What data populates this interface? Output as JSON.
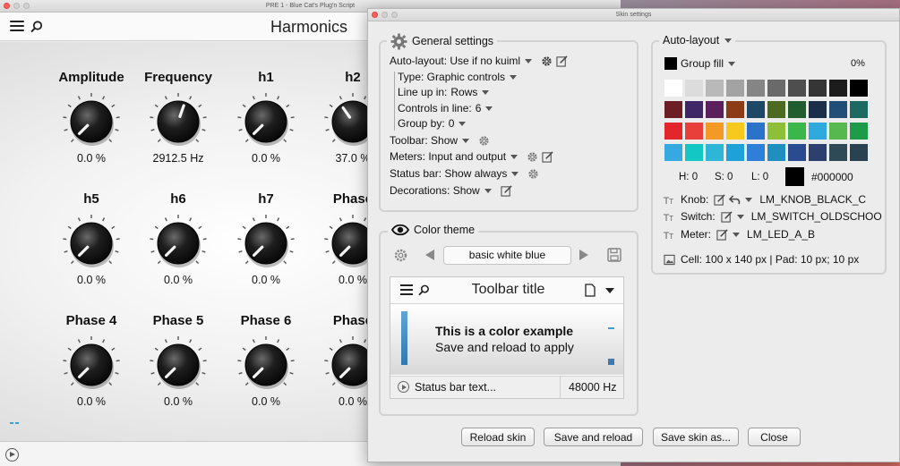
{
  "plugin": {
    "window_title": "PRE 1 - Blue Cat's Plug'n Script",
    "title": "Harmonics",
    "knobs": [
      {
        "label": "Amplitude",
        "value": "0.0 %",
        "level": 0.0
      },
      {
        "label": "Frequency",
        "value": "2912.5 Hz",
        "level": 0.57
      },
      {
        "label": "h1",
        "value": "0.0 %",
        "level": 0.0
      },
      {
        "label": "h2",
        "value": "37.0 %",
        "level": 0.37
      },
      {
        "label": "h5",
        "value": "0.0 %",
        "level": 0.0
      },
      {
        "label": "h6",
        "value": "0.0 %",
        "level": 0.0
      },
      {
        "label": "h7",
        "value": "0.0 %",
        "level": 0.0
      },
      {
        "label": "Phase",
        "value": "0.0 %",
        "level": 0.0
      },
      {
        "label": "Phase 4",
        "value": "0.0 %",
        "level": 0.0
      },
      {
        "label": "Phase 5",
        "value": "0.0 %",
        "level": 0.0
      },
      {
        "label": "Phase 6",
        "value": "0.0 %",
        "level": 0.0
      },
      {
        "label": "Phase",
        "value": "0.0 %",
        "level": 0.0
      }
    ]
  },
  "skin": {
    "window_title": "Skin settings",
    "general": {
      "title": "General settings",
      "auto_layout": "Auto-layout: Use if no kuiml",
      "type": "Type: Graphic controls",
      "line_up": "Line up in:",
      "line_up_value": "Rows",
      "controls_in_line": "Controls in line:",
      "controls_in_line_value": "6",
      "group_by": "Group by:",
      "group_by_value": "0",
      "toolbar": "Toolbar: Show",
      "meters": "Meters: Input and output",
      "status_bar": "Status bar: Show always",
      "decorations": "Decorations: Show"
    },
    "color_theme": {
      "title": "Color theme",
      "theme_name": "basic white blue",
      "preview_toolbar_title": "Toolbar title",
      "preview_line1": "This is a color example",
      "preview_line2": "Save and reload to apply",
      "preview_status": "Status bar text...",
      "preview_rate": "48000 Hz"
    },
    "auto_layout": {
      "title": "Auto-layout",
      "group_fill": "Group fill",
      "opacity": "0%",
      "hue": "H: 0",
      "sat": "S: 0",
      "light": "L: 0",
      "hex": "#000000",
      "knob_label": "Knob:",
      "knob_value": "LM_KNOB_BLACK_C",
      "switch_label": "Switch:",
      "switch_value": "LM_SWITCH_OLDSCHOO",
      "meter_label": "Meter:",
      "meter_value": "LM_LED_A_B",
      "cell": "Cell: 100 x 140 px | Pad: 10 px; 10 px"
    },
    "buttons": {
      "reload": "Reload skin",
      "save_reload": "Save and reload",
      "save_as": "Save skin as...",
      "close": "Close"
    },
    "palette": [
      [
        "#ffffff",
        "#dcdcdc",
        "#b9b9b9",
        "#a3a3a3",
        "#858585",
        "#6a6a6a",
        "#4e4e4e",
        "#353535",
        "#1c1c1c",
        "#000000"
      ],
      [
        "#6b1f24",
        "#3f2767",
        "#5b1f5c",
        "#8c3b16",
        "#1f4766",
        "#4d6a22",
        "#215e2f",
        "#1b2f4a",
        "#214f78",
        "#1d6a63"
      ],
      [
        "#e3262b",
        "#e83f3a",
        "#f29a25",
        "#f7c81e",
        "#2b73c9",
        "#8dbf38",
        "#3bb64a",
        "#2fa9de",
        "#58b850",
        "#1d9b48"
      ],
      [
        "#36a9e1",
        "#12c7c4",
        "#2eb6d9",
        "#1ea0d9",
        "#2e7fd8",
        "#1e8fbf",
        "#2a4b8f",
        "#2d3f6e",
        "#2d4a56",
        "#294252"
      ]
    ]
  }
}
